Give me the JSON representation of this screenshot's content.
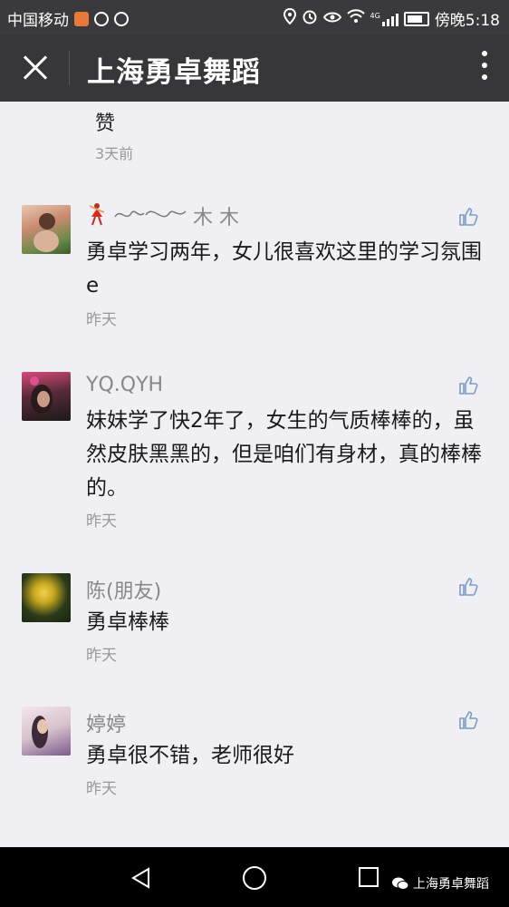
{
  "status_bar": {
    "carrier": "中国移动",
    "signal_label": "4G",
    "time": "傍晚5:18"
  },
  "title_bar": {
    "title": "上海勇卓舞蹈"
  },
  "top_comment": {
    "text": "赞",
    "time": "3天前"
  },
  "comments": [
    {
      "name": "木 木",
      "text": "勇卓学习两年，女儿很喜欢这里的学习氛围e",
      "time": "昨天"
    },
    {
      "name": "YQ.QYH",
      "text": "妹妹学了快2年了，女生的气质棒棒的，虽然皮肤黑黑的，但是咱们有身材，真的棒棒的。",
      "time": "昨天"
    },
    {
      "name": "陈(朋友)",
      "text": "勇卓棒棒",
      "time": "昨天"
    },
    {
      "name": "婷婷",
      "text": "勇卓很不错，老师很好",
      "time": "昨天"
    }
  ],
  "watermark": {
    "text": "上海勇卓舞蹈"
  }
}
